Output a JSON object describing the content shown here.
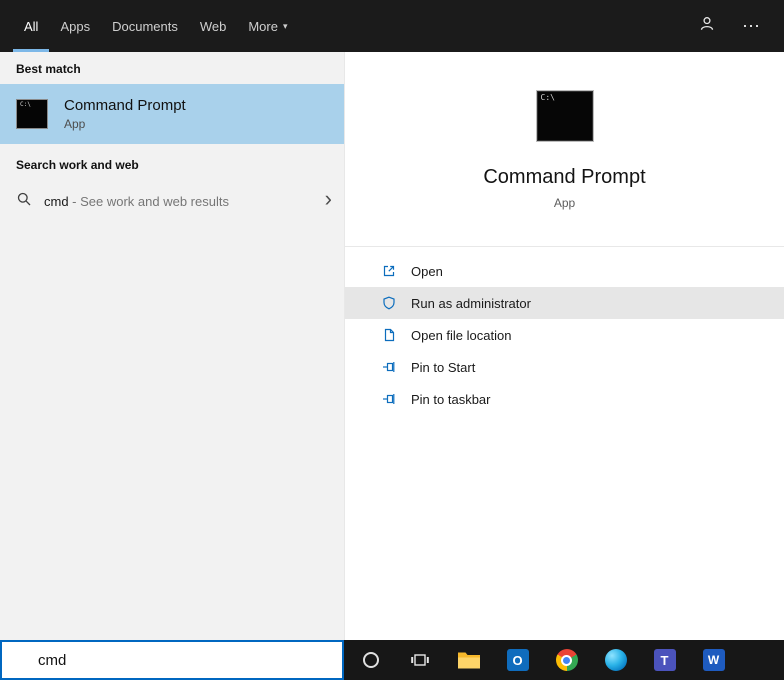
{
  "header": {
    "tabs": [
      "All",
      "Apps",
      "Documents",
      "Web",
      "More"
    ],
    "more_caret": "▾",
    "more_glyph": "⋯"
  },
  "left": {
    "best_match_label": "Best match",
    "best_match": {
      "title": "Command Prompt",
      "subtitle": "App"
    },
    "search_web_label": "Search work and web",
    "suggestion": {
      "query": "cmd",
      "rest": " - See work and web results"
    },
    "chevron_glyph": "›"
  },
  "right": {
    "app": {
      "title": "Command Prompt",
      "subtitle": "App",
      "icon_glyph": "C:\\"
    },
    "actions": [
      {
        "label": "Open"
      },
      {
        "label": "Run as administrator",
        "highlighted": true
      },
      {
        "label": "Open file location"
      },
      {
        "label": "Pin to Start"
      },
      {
        "label": "Pin to taskbar"
      }
    ]
  },
  "search_box": {
    "value": "cmd"
  },
  "taskbar": {
    "outlook_glyph": "O",
    "teams_glyph": "T",
    "word_glyph": "W"
  },
  "colors": {
    "accent": "#0067c0",
    "header_bg": "#1b1b1b",
    "best_match_highlight": "#a9d1eb",
    "action_highlight": "#e6e6e6",
    "left_panel_bg": "#f2f2f2"
  }
}
